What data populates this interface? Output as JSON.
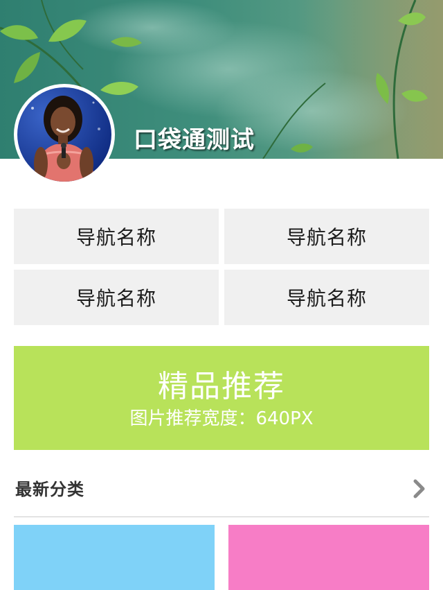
{
  "header": {
    "title": "口袋通测试"
  },
  "nav": {
    "items": [
      {
        "label": "导航名称"
      },
      {
        "label": "导航名称"
      },
      {
        "label": "导航名称"
      },
      {
        "label": "导航名称"
      }
    ]
  },
  "promo": {
    "title": "精品推荐",
    "subtitle": "图片推荐宽度：640PX",
    "color": "#b8e25a"
  },
  "section": {
    "title": "最新分类",
    "icon": "chevron-right-icon"
  },
  "tiles": [
    {
      "color": "#7fd2f8"
    },
    {
      "color": "#f77dc6"
    }
  ]
}
